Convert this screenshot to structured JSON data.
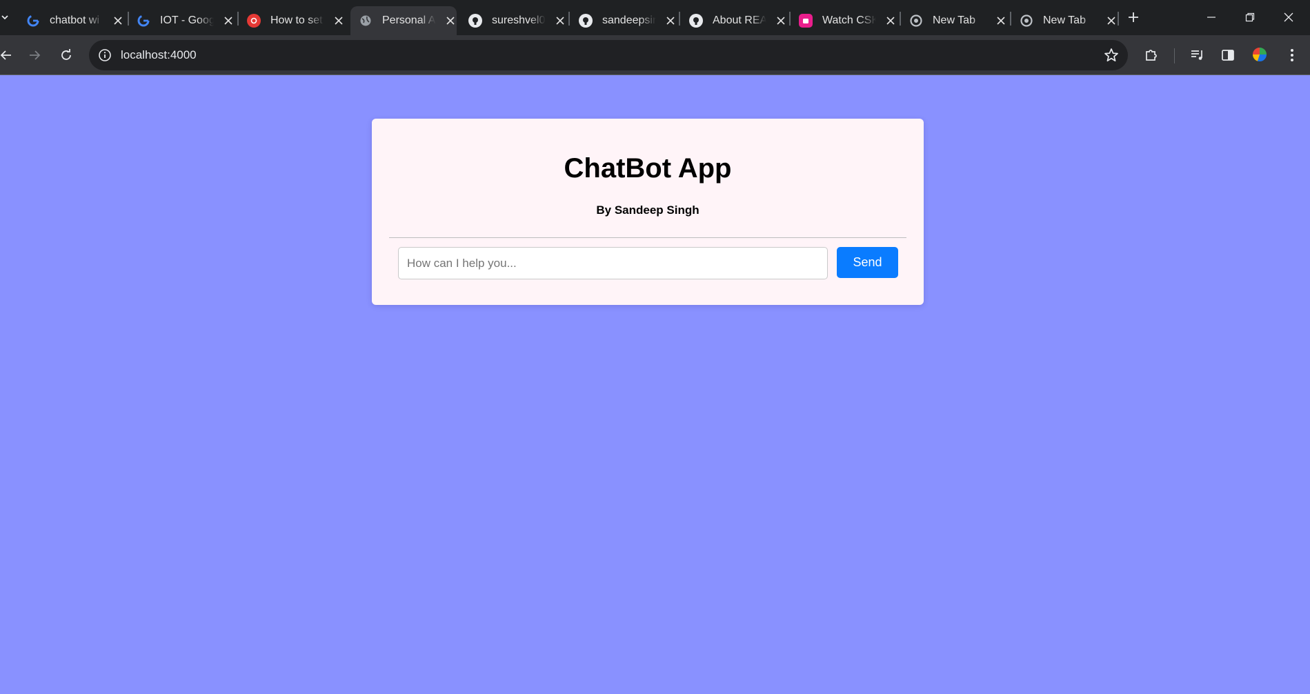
{
  "browser": {
    "tabs": [
      {
        "title": "chatbot wi",
        "favicon": "google-icon",
        "active": false
      },
      {
        "title": "IOT - Goog",
        "favicon": "google-icon",
        "active": false
      },
      {
        "title": "How to set",
        "favicon": "red-circle-icon",
        "active": false
      },
      {
        "title": "Personal A",
        "favicon": "globe-icon",
        "active": true
      },
      {
        "title": "sureshvel0",
        "favicon": "github-icon",
        "active": false
      },
      {
        "title": "sandeepsin",
        "favicon": "github-icon",
        "active": false
      },
      {
        "title": "About REA",
        "favicon": "github-icon",
        "active": false
      },
      {
        "title": "Watch CSK",
        "favicon": "pink-app-icon",
        "active": false
      },
      {
        "title": "New Tab",
        "favicon": "chrome-icon",
        "active": false
      },
      {
        "title": "New Tab",
        "favicon": "chrome-icon",
        "active": false
      }
    ],
    "address": "localhost:4000",
    "colors": {
      "tabstrip": "#1f2123",
      "toolbar": "#35363a",
      "omnibox": "#202124"
    }
  },
  "page": {
    "title": "ChatBot App",
    "subtitle": "By Sandeep Singh",
    "input_placeholder": "How can I help you...",
    "input_value": "",
    "send_label": "Send",
    "colors": {
      "background": "#8991ff",
      "card": "#fff4f8",
      "send_button": "#0a7cff"
    }
  }
}
